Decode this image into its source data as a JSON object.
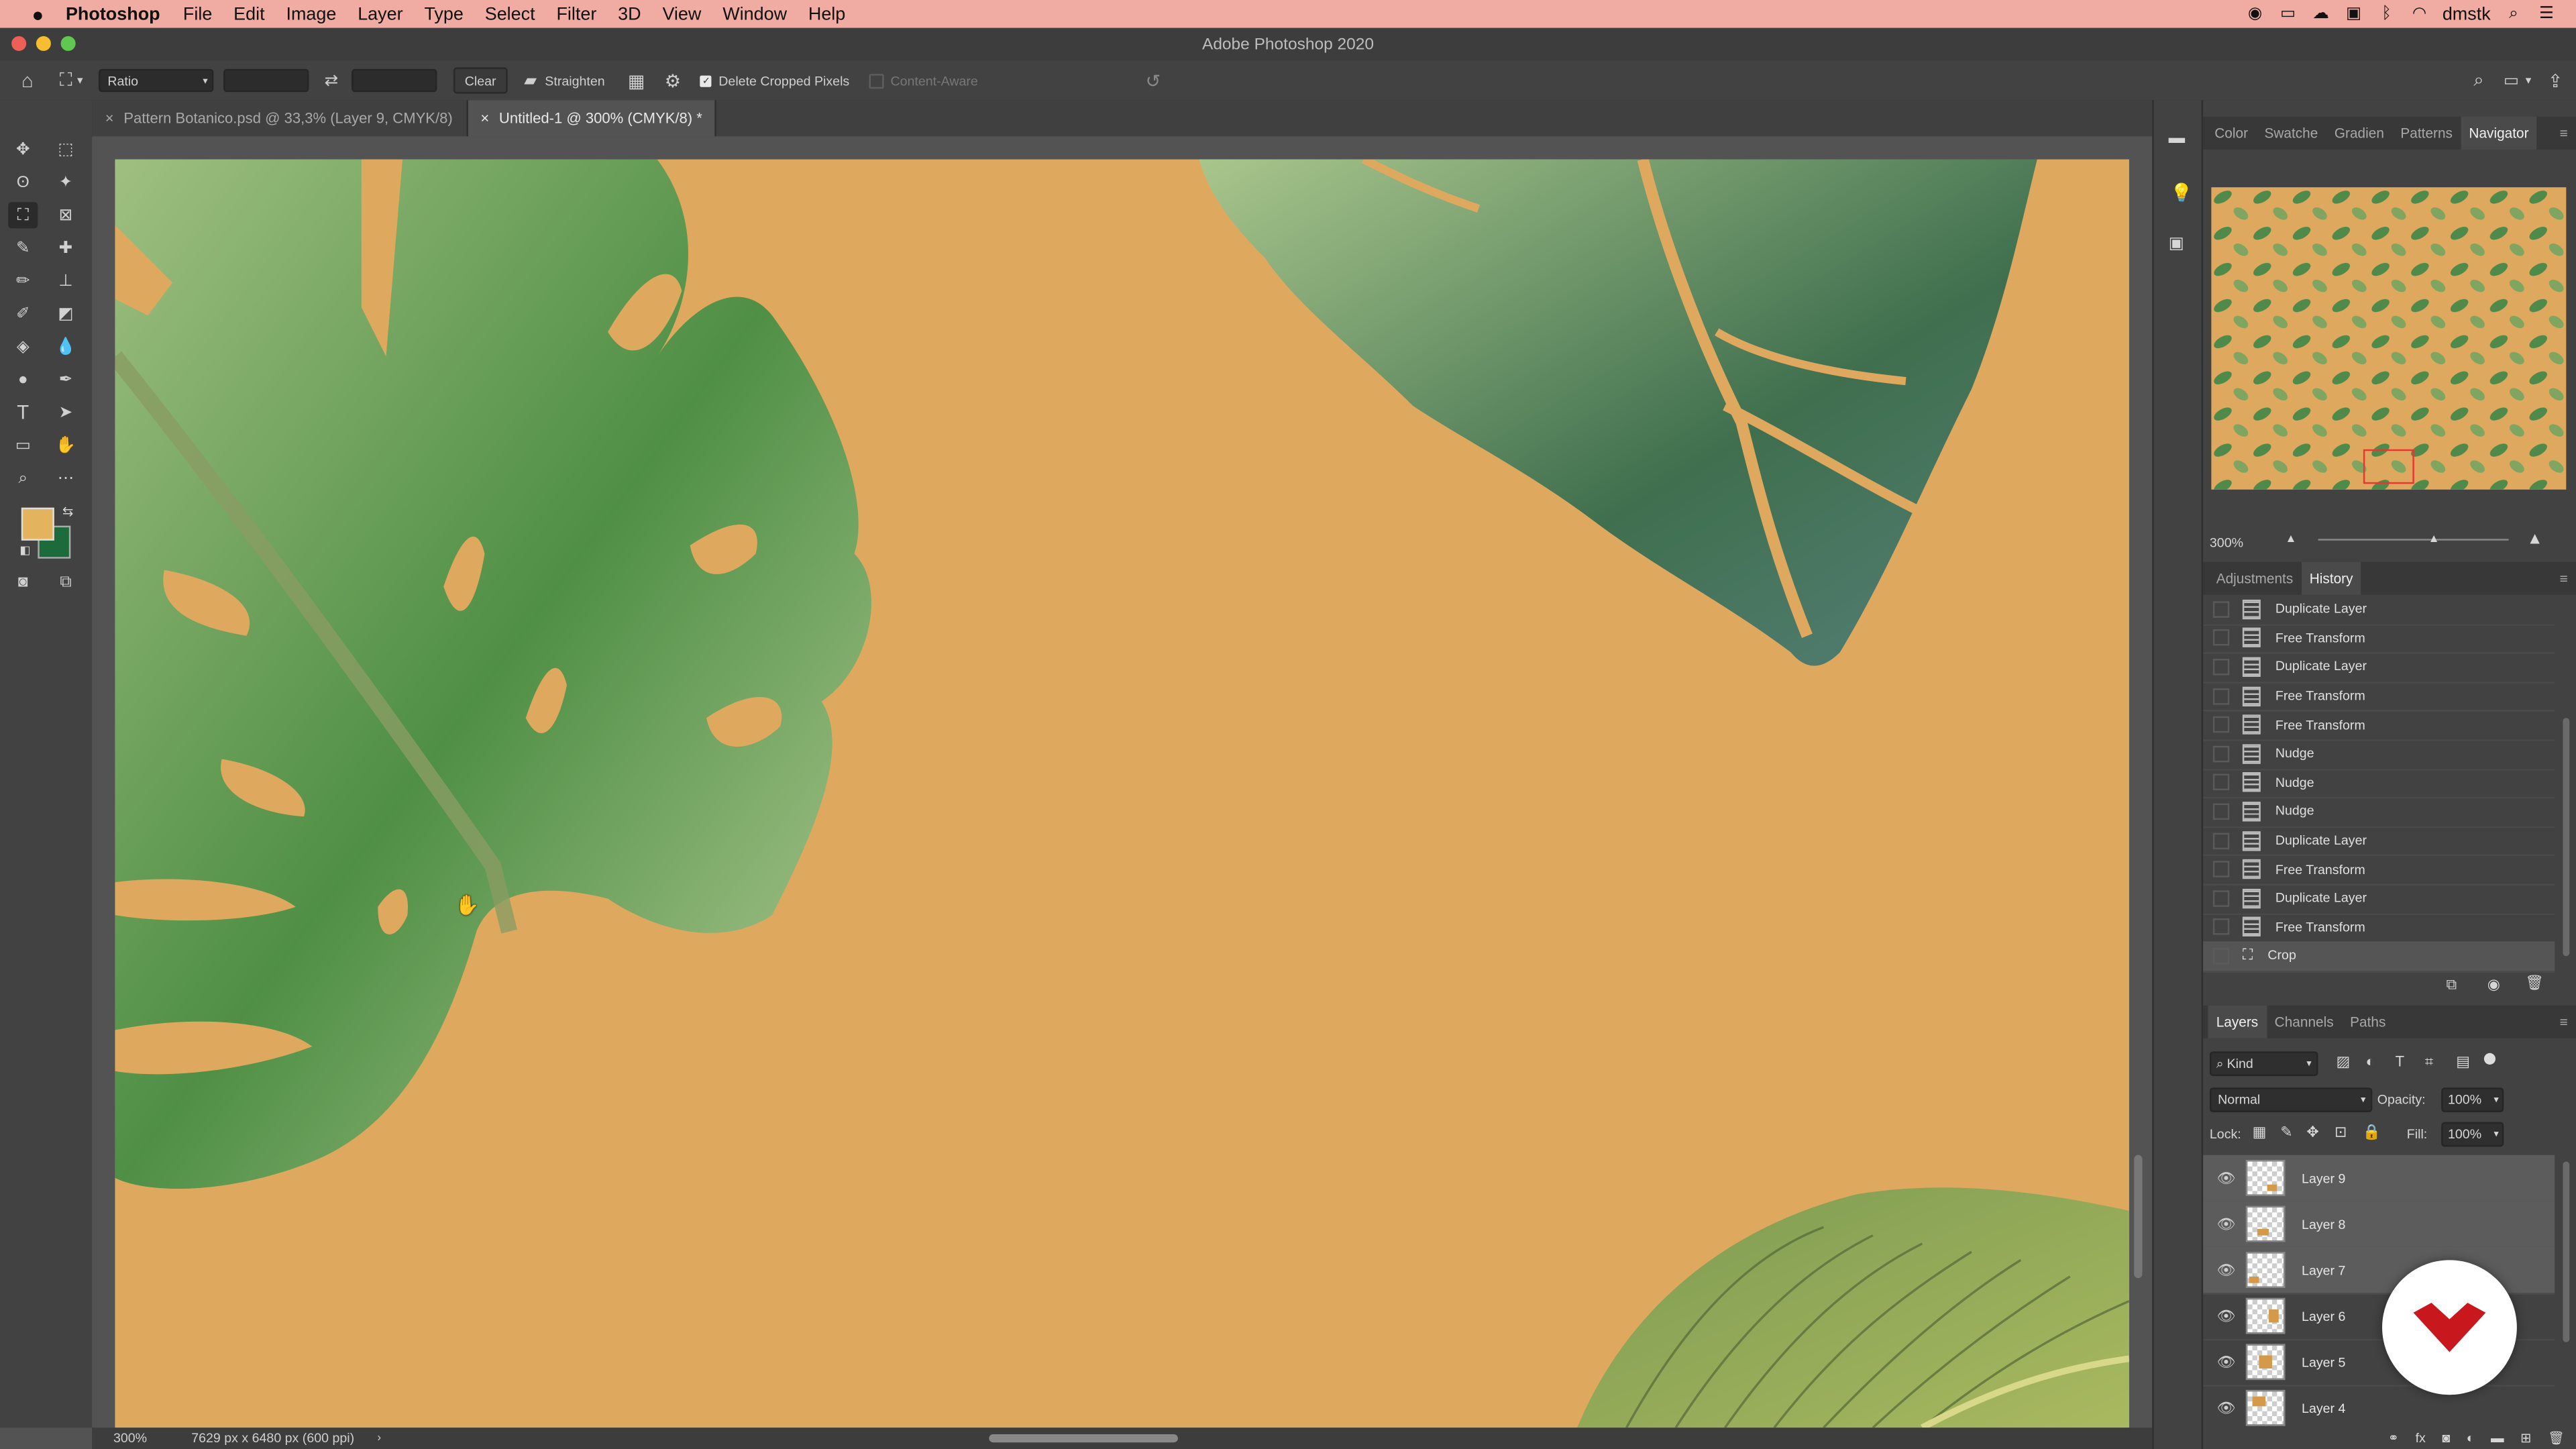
{
  "menubar": {
    "app_name": "Photoshop",
    "items": [
      "File",
      "Edit",
      "Image",
      "Layer",
      "Type",
      "Select",
      "Filter",
      "3D",
      "View",
      "Window",
      "Help"
    ],
    "user": "dmstk"
  },
  "window": {
    "title": "Adobe Photoshop 2020"
  },
  "options": {
    "ratio": "Ratio",
    "clear": "Clear",
    "straighten": "Straighten",
    "delete_cropped": "Delete Cropped Pixels",
    "content_aware": "Content-Aware"
  },
  "tabs": [
    {
      "label": "Pattern Botanico.psd @ 33,3% (Layer 9, CMYK/8)"
    },
    {
      "label": "Untitled-1 @ 300% (CMYK/8) *"
    }
  ],
  "status": {
    "zoom": "300%",
    "doc_size": "7629 px x 6480 px (600 ppi)"
  },
  "panels": {
    "top_tabs": [
      "Color",
      "Swatche",
      "Gradien",
      "Patterns",
      "Navigator"
    ],
    "navigator_zoom": "300%",
    "mid_tabs": [
      "Adjustments",
      "History"
    ],
    "history": [
      "Duplicate Layer",
      "Free Transform",
      "Duplicate Layer",
      "Free Transform",
      "Free Transform",
      "Nudge",
      "Nudge",
      "Nudge",
      "Duplicate Layer",
      "Free Transform",
      "Duplicate Layer",
      "Free Transform",
      "Crop"
    ],
    "layer_tabs": [
      "Layers",
      "Channels",
      "Paths"
    ],
    "kind": "Kind",
    "blend_mode": "Normal",
    "opacity_label": "Opacity:",
    "opacity": "100%",
    "lock_label": "Lock:",
    "fill_label": "Fill:",
    "fill": "100%",
    "layers": [
      "Layer 9",
      "Layer 8",
      "Layer 7",
      "Layer 6",
      "Layer 5",
      "Layer 4"
    ]
  },
  "colors": {
    "canvas": "#dfa85f",
    "menubar": "#f0aba2",
    "foreground": "#e3b35e",
    "background": "#1d6b3a"
  }
}
